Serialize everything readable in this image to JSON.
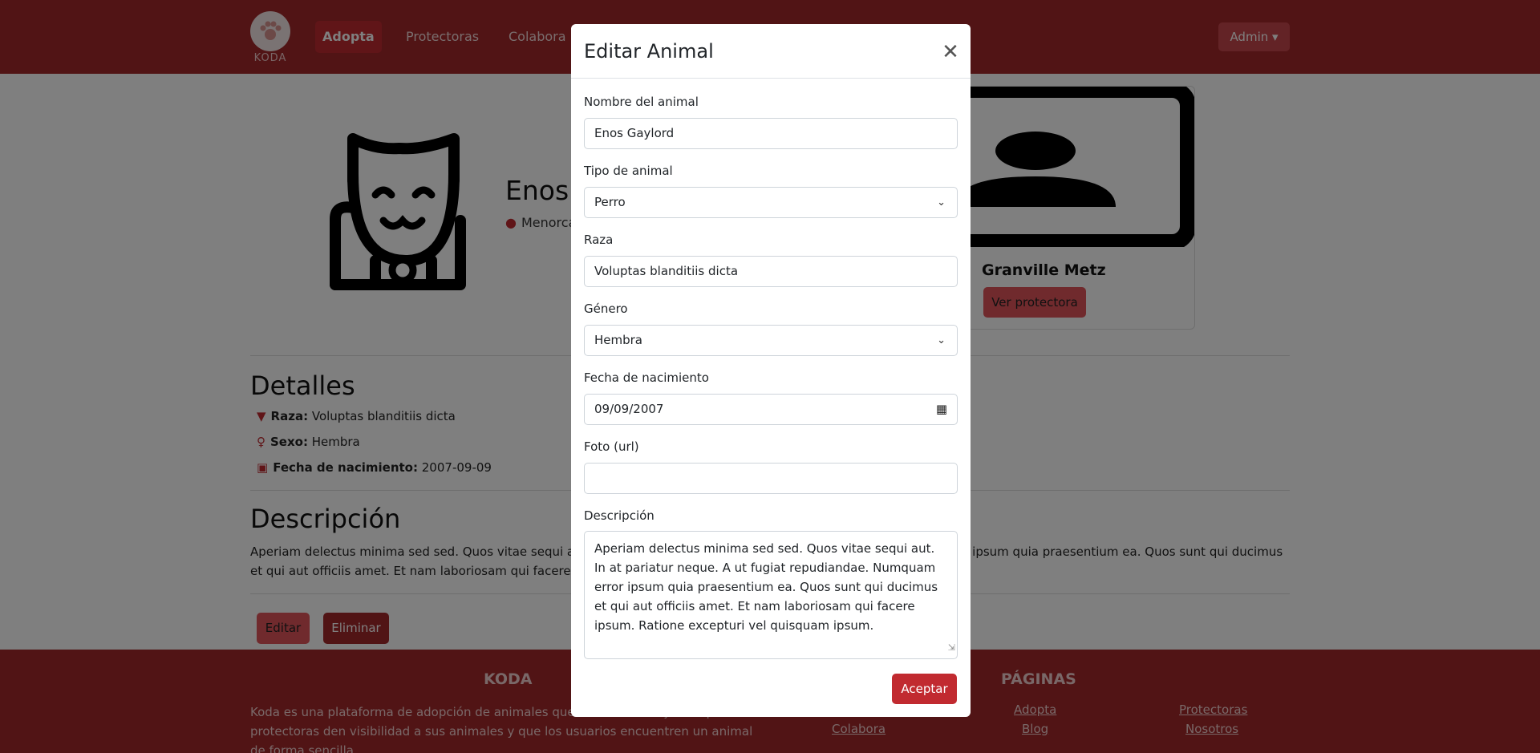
{
  "nav": {
    "brand": "KODA",
    "links": [
      "Adopta",
      "Protectoras",
      "Colabora"
    ],
    "admin_label": "Admin ▾"
  },
  "animal": {
    "name_visible": "Enos C",
    "location_visible": "Menorca",
    "icon": "cat-icon"
  },
  "protectora": {
    "name": "Granville Metz",
    "button": "Ver protectora",
    "icon": "user-placeholder-icon"
  },
  "details": {
    "heading": "Detalles",
    "raza_label": "Raza:",
    "raza_value": "Voluptas blanditiis dicta",
    "sexo_label": "Sexo:",
    "sexo_value": "Hembra",
    "fecha_label": "Fecha de nacimiento:",
    "fecha_value": "2007-09-09"
  },
  "description": {
    "heading": "Descripción",
    "text_visible": "Aperiam delectus minima sed sed. Quos vitae sequi aut. In at pariatur neque. A ut fugiat repudiandae. Numquam error ipsum quia praesentium ea. Quos sunt qui ducimus et qui aut officiis amet. Et nam laboriosam qui facere ipsum. Ratione excepturi vel quisquam ipsum."
  },
  "actions": {
    "edit": "Editar",
    "delete": "Eliminar"
  },
  "footer": {
    "koda_title": "KODA",
    "koda_text": "Koda es una plataforma de adopción de animales que tiene como objetivo que las protectoras den visibilidad a sus animales y que los usuarios encuentren un animal de forma sencilla",
    "paginas_title": "PÁGINAS",
    "links": [
      "Colabora",
      "Adopta",
      "Blog",
      "Protectoras",
      "Nosotros"
    ]
  },
  "modal": {
    "title": "Editar Animal",
    "fields": {
      "nombre_label": "Nombre del animal",
      "nombre_value": "Enos Gaylord",
      "tipo_label": "Tipo de animal",
      "tipo_value": "Perro",
      "raza_label": "Raza",
      "raza_value": "Voluptas blanditiis dicta",
      "genero_label": "Género",
      "genero_value": "Hembra",
      "fecha_label": "Fecha de nacimiento",
      "fecha_value": "09/09/2007",
      "foto_label": "Foto (url)",
      "foto_value": "",
      "descripcion_label": "Descripción",
      "descripcion_value": "Aperiam delectus minima sed sed. Quos vitae sequi aut. In at pariatur neque. A ut fugiat repudiandae. Numquam error ipsum quia praesentium ea. Quos sunt qui ducimus et qui aut officiis amet. Et nam laboriosam qui facere ipsum. Ratione excepturi vel quisquam ipsum."
    },
    "accept": "Aceptar"
  },
  "colors": {
    "primary": "#a3282b",
    "accent": "#c12a30",
    "light_accent": "#e0555b"
  }
}
